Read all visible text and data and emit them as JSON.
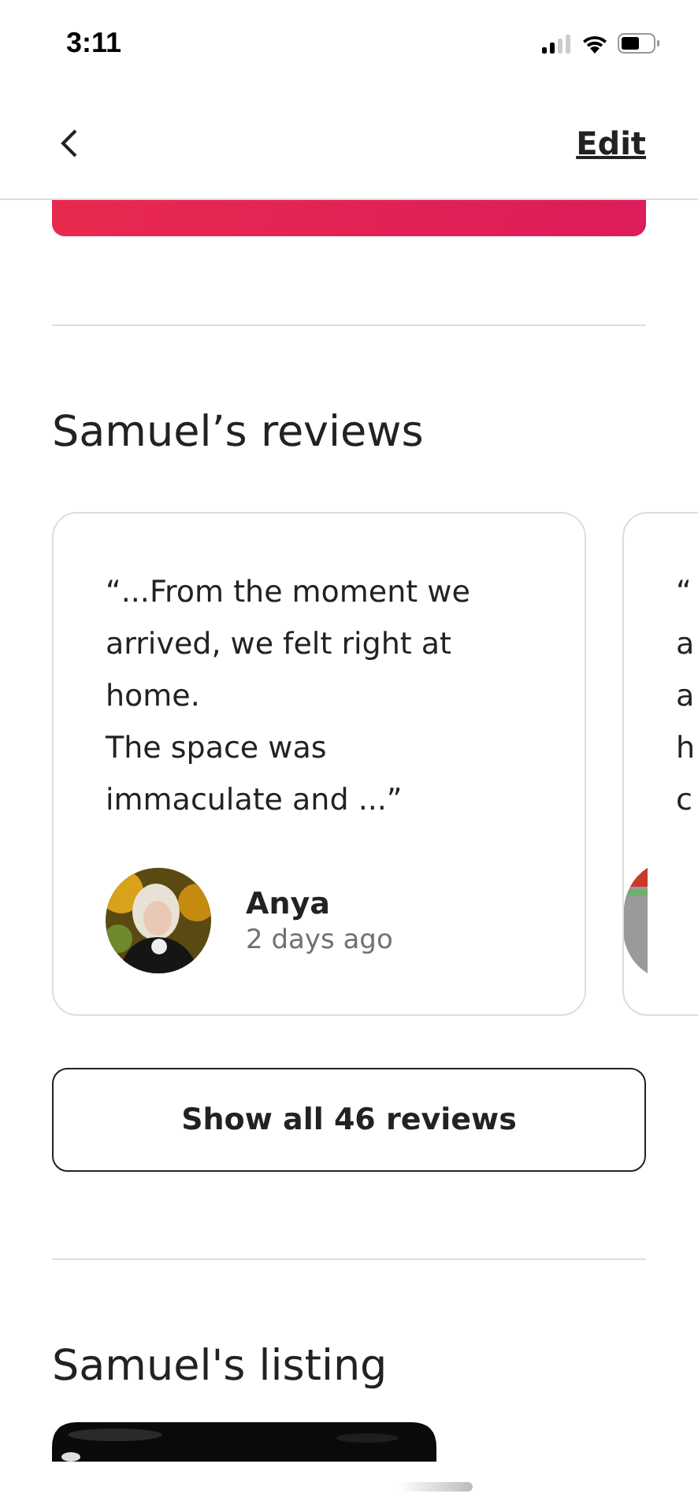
{
  "status_bar": {
    "time": "3:11"
  },
  "nav": {
    "action": "Edit"
  },
  "reviews": {
    "title": "Samuel’s reviews",
    "cards": [
      {
        "quote": "“...From the moment we\narrived, we felt right at\nhome.\nThe space was\nimmaculate and ...”",
        "reviewer": "Anya",
        "time": "2 days ago"
      },
      {
        "quote": "“\na\na\nh\nc"
      }
    ],
    "show_all": "Show all 46 reviews"
  },
  "listing": {
    "title": "Samuel's listing"
  }
}
